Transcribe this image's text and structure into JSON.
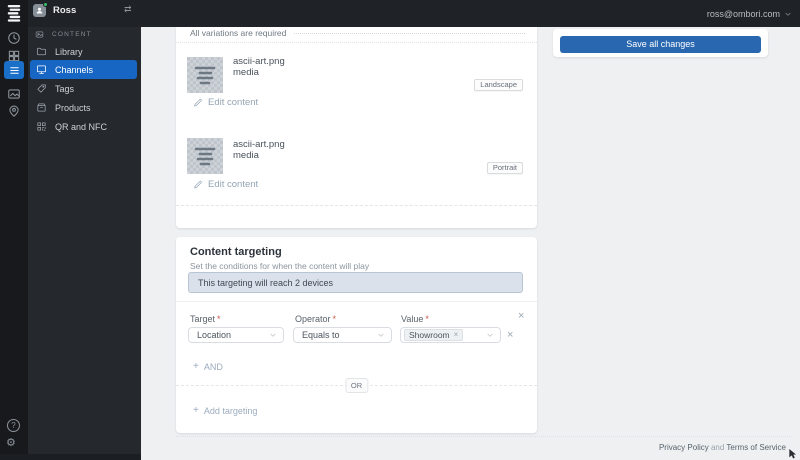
{
  "topbar": {
    "user_name": "Ross",
    "account_email": "ross@ombori.com"
  },
  "sidebar": {
    "section": "CONTENT",
    "items": [
      {
        "label": "Library",
        "icon": "folder-icon"
      },
      {
        "label": "Channels",
        "icon": "display-icon",
        "active": true
      },
      {
        "label": "Tags",
        "icon": "tag-icon"
      },
      {
        "label": "Products",
        "icon": "box-icon"
      },
      {
        "label": "QR and NFC",
        "icon": "qr-icon"
      }
    ]
  },
  "variations": {
    "note": "All variations are required",
    "items": [
      {
        "name": "ascii-art.png media",
        "orientation_badge": "Landscape",
        "edit_label": "Edit content"
      },
      {
        "name": "ascii-art.png media",
        "orientation_badge": "Portrait",
        "edit_label": "Edit content"
      }
    ]
  },
  "targeting": {
    "title": "Content targeting",
    "subtitle": "Set the conditions for when the content will play",
    "reach_message": "This targeting will reach 2 devices",
    "required_mark": "*",
    "rule": {
      "target_label": "Target",
      "target_value": "Location",
      "operator_label": "Operator",
      "operator_value": "Equals to",
      "value_label": "Value",
      "value_tag": "Showroom"
    },
    "plus": "+",
    "and_label": "AND",
    "or_label": "OR",
    "add_label": "Add targeting",
    "remove_glyph": "×"
  },
  "actions": {
    "save_label": "Save all changes"
  },
  "footer": {
    "privacy_label": "Privacy Policy",
    "conjunction": "and",
    "terms_label": "Terms of Service"
  },
  "icons": {
    "gear": "⚙",
    "help": "?",
    "swap": "⇄"
  },
  "colors": {
    "rail_active_blue": "#1a6fc9",
    "sidebar_active_blue": "#1766c4",
    "save_button_blue": "#2968b0",
    "reach_bar_bg": "#dae1ea",
    "reach_bar_border": "#bac5d3",
    "online_dot_green": "#35c06e"
  }
}
